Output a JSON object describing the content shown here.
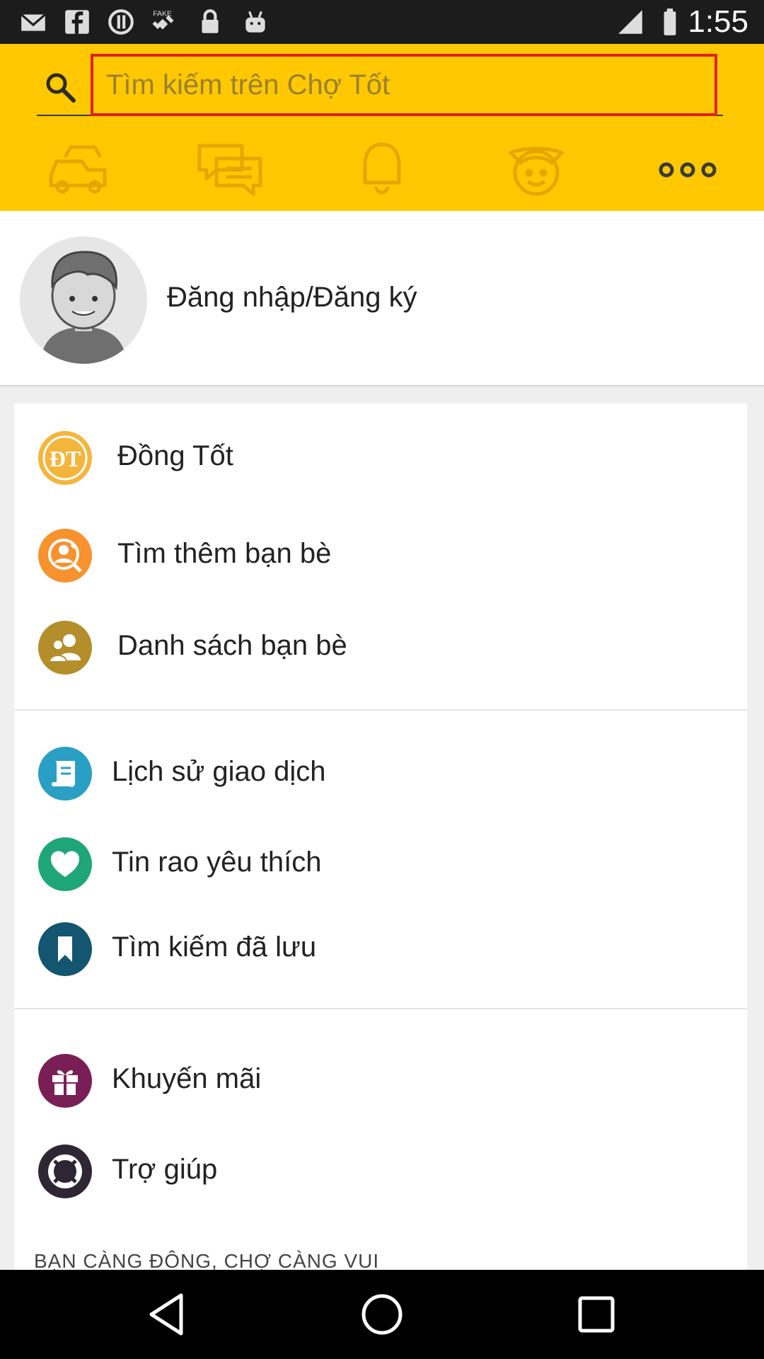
{
  "status_bar": {
    "time": "1:55",
    "icons": [
      "mail-icon",
      "facebook-icon",
      "alert-circle-icon",
      "fake-gps-icon",
      "lock-icon",
      "android-icon",
      "signal-icon",
      "battery-icon"
    ]
  },
  "search": {
    "placeholder": "Tìm kiếm trên Chợ Tốt"
  },
  "tabs": [
    "car-icon",
    "chat-icon",
    "bell-icon",
    "face-icon",
    "more-icon"
  ],
  "profile": {
    "login_label": "Đăng nhập/Đăng ký"
  },
  "menu": {
    "groups": [
      [
        {
          "label": "Đồng Tốt",
          "icon": "dong-tot-coin-icon",
          "color": "#f4b53c"
        },
        {
          "label": "Tìm thêm bạn bè",
          "icon": "find-friend-icon",
          "color": "#f7922e"
        },
        {
          "label": "Danh sách bạn bè",
          "icon": "friends-list-icon",
          "color": "#b48e2a"
        }
      ],
      [
        {
          "label": "Lịch sử giao dịch",
          "icon": "receipt-icon",
          "color": "#2a9fc4"
        },
        {
          "label": "Tin rao yêu thích",
          "icon": "heart-icon",
          "color": "#1fa678"
        },
        {
          "label": "Tìm kiếm đã lưu",
          "icon": "bookmark-icon",
          "color": "#14566f"
        }
      ],
      [
        {
          "label": "Khuyến mãi",
          "icon": "gift-icon",
          "color": "#7a1f55"
        },
        {
          "label": "Trợ giúp",
          "icon": "lifebuoy-icon",
          "color": "#2f2633"
        }
      ]
    ],
    "footer": "BẠN CÀNG ĐÔNG, CHỢ CÀNG VUI"
  },
  "nav": [
    "back-icon",
    "home-icon",
    "recents-icon"
  ],
  "colors": {
    "header_yellow": "#ffc800",
    "highlight_red": "#e42020"
  }
}
